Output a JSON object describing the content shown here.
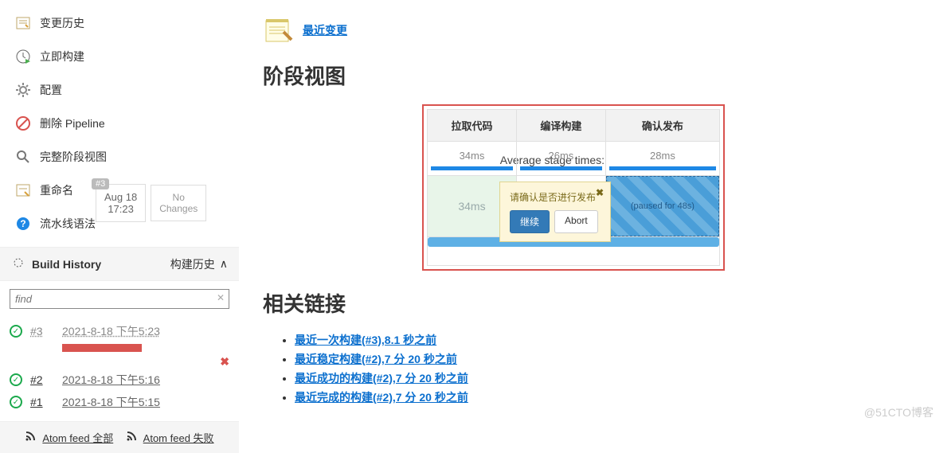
{
  "sidebar": {
    "items": [
      {
        "label": "变更历史",
        "icon": "history"
      },
      {
        "label": "立即构建",
        "icon": "clock-play"
      },
      {
        "label": "配置",
        "icon": "gear"
      },
      {
        "label": "删除 Pipeline",
        "icon": "no"
      },
      {
        "label": "完整阶段视图",
        "icon": "zoom"
      },
      {
        "label": "重命名",
        "icon": "rename"
      },
      {
        "label": "流水线语法",
        "icon": "help"
      }
    ]
  },
  "history": {
    "title": "Build History",
    "trend": "构建历史",
    "filter_placeholder": "find",
    "rows": [
      {
        "num": "#3",
        "ts": "2021-8-18 下午5:23",
        "running": true
      },
      {
        "num": "#2",
        "ts": "2021-8-18 下午5:16",
        "running": false
      },
      {
        "num": "#1",
        "ts": "2021-8-18 下午5:15",
        "running": false
      }
    ],
    "feed_all": "Atom feed 全部",
    "feed_fail": "Atom feed 失败"
  },
  "recent_changes": "最近变更",
  "stage_view": {
    "title": "阶段视图",
    "avg_label": "Average stage times:",
    "headers": [
      "拉取代码",
      "编译构建",
      "确认发布"
    ],
    "avgs": [
      "34ms",
      "26ms",
      "28ms"
    ],
    "run": {
      "badge": "#3",
      "date": "Aug 18",
      "time": "17:23",
      "nochange": "No\nChanges",
      "cell1": "34ms",
      "paused": "(paused for 48s)"
    },
    "popup": {
      "title": "请确认是否进行发布",
      "ok": "继续",
      "abort": "Abort"
    }
  },
  "related": {
    "title": "相关链接",
    "links": [
      "最近一次构建(#3),8.1 秒之前",
      "最近稳定构建(#2),7 分 20 秒之前",
      "最近成功的构建(#2),7 分 20 秒之前",
      "最近完成的构建(#2),7 分 20 秒之前"
    ]
  },
  "watermark": "@51CTO博客"
}
